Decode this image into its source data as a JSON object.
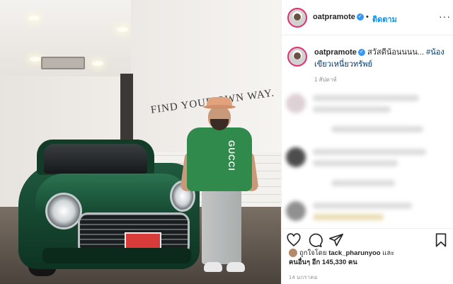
{
  "photo": {
    "wall_text": "FIND YOUR OWN WAY.",
    "shirt_text": "GUCCI"
  },
  "header": {
    "username": "oatpramote",
    "verified_icon": "verified-badge-icon",
    "separator": "•",
    "follow_label": "ติดตาม",
    "more_label": "···"
  },
  "caption": {
    "username": "oatpramote",
    "text": "สวัสดีน้อนนนน... ",
    "hashtag": "#น้องเขียวเหนี่ยวทรัพย์",
    "age": "1 สัปดาห์"
  },
  "actions": {
    "icons": [
      "heart-icon",
      "comment-icon",
      "share-icon",
      "bookmark-icon"
    ]
  },
  "likes": {
    "liked_by_prefix": "ถูกใจโดย",
    "liked_by_user": "tack_pharunyoo",
    "and_label": "และ",
    "others_prefix": "คนอื่นๆ อีก",
    "count": "145,330",
    "unit": "คน"
  },
  "date": "14 มกราคม"
}
